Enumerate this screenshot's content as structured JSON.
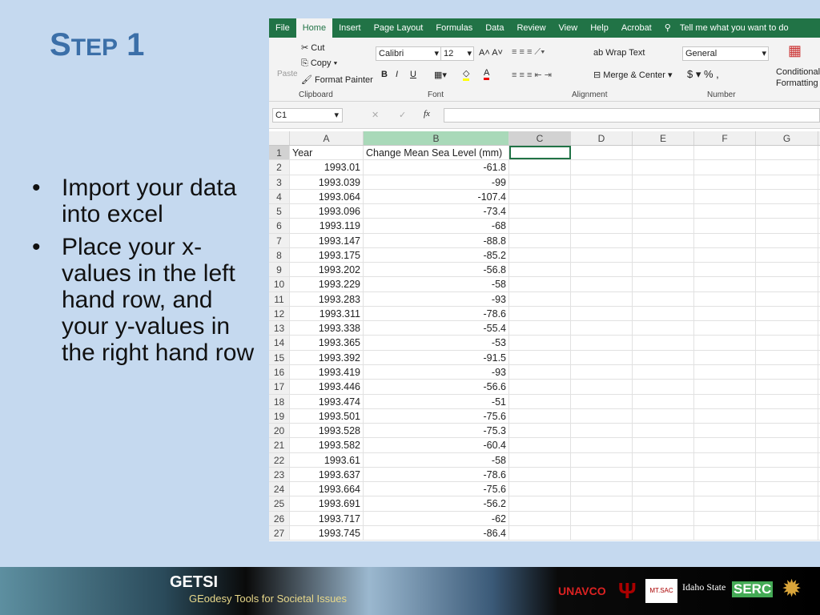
{
  "slide": {
    "title_first": "S",
    "title_rest": "TEP",
    "title_num": "1",
    "bullets": [
      "Import your data into excel",
      "Place your x-values in the left hand row, and your y-values in the right hand row"
    ]
  },
  "excel": {
    "tabs": [
      "File",
      "Home",
      "Insert",
      "Page Layout",
      "Formulas",
      "Data",
      "Review",
      "View",
      "Help",
      "Acrobat"
    ],
    "tell_me": "Tell me what you want to do",
    "clipboard": {
      "paste": "Paste",
      "cut": "Cut",
      "copy": "Copy",
      "format_painter": "Format Painter",
      "label": "Clipboard"
    },
    "font": {
      "name": "Calibri",
      "size": "12",
      "label": "Font",
      "bold": "B",
      "italic": "I",
      "underline": "U"
    },
    "alignment": {
      "wrap": "Wrap Text",
      "merge": "Merge & Center",
      "label": "Alignment"
    },
    "number": {
      "format": "General",
      "currency": "$",
      "percent": "%",
      "comma": ",",
      "label": "Number"
    },
    "styles": {
      "conditional": "Conditional",
      "formatting": "Formatting"
    },
    "name_box": "C1",
    "fx": "fx",
    "columns": [
      "A",
      "B",
      "C",
      "D",
      "E",
      "F",
      "G"
    ],
    "header_row": [
      "Year",
      "Change Mean Sea Level (mm)"
    ],
    "rows": [
      [
        "1993.01",
        "-61.8"
      ],
      [
        "1993.039",
        "-99"
      ],
      [
        "1993.064",
        "-107.4"
      ],
      [
        "1993.096",
        "-73.4"
      ],
      [
        "1993.119",
        "-68"
      ],
      [
        "1993.147",
        "-88.8"
      ],
      [
        "1993.175",
        "-85.2"
      ],
      [
        "1993.202",
        "-56.8"
      ],
      [
        "1993.229",
        "-58"
      ],
      [
        "1993.283",
        "-93"
      ],
      [
        "1993.311",
        "-78.6"
      ],
      [
        "1993.338",
        "-55.4"
      ],
      [
        "1993.365",
        "-53"
      ],
      [
        "1993.392",
        "-91.5"
      ],
      [
        "1993.419",
        "-93"
      ],
      [
        "1993.446",
        "-56.6"
      ],
      [
        "1993.474",
        "-51"
      ],
      [
        "1993.501",
        "-75.6"
      ],
      [
        "1993.528",
        "-75.3"
      ],
      [
        "1993.582",
        "-60.4"
      ],
      [
        "1993.61",
        "-58"
      ],
      [
        "1993.637",
        "-78.6"
      ],
      [
        "1993.664",
        "-75.6"
      ],
      [
        "1993.691",
        "-56.2"
      ],
      [
        "1993.717",
        "-62"
      ],
      [
        "1993.745",
        "-86.4"
      ]
    ],
    "accent": "#217346"
  },
  "footer": {
    "getsi": "GETSI",
    "tagline": "GEodesy Tools for Societal Issues",
    "logos": [
      "UNAVCO",
      "MT.SAC",
      "Idaho State University",
      "SERC",
      "NSF"
    ]
  }
}
